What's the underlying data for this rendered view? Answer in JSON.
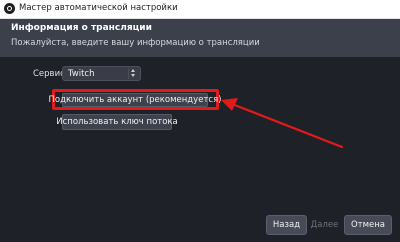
{
  "window": {
    "title": "Мастер автоматической настройки"
  },
  "header": {
    "heading": "Информация о трансляции",
    "subtitle": "Пожалуйста, введите вашу информацию о трансляции"
  },
  "form": {
    "service_label": "Сервис",
    "service_value": "Twitch",
    "connect_button": "Подключить аккаунт (рекомендуется)",
    "stream_key_button": "Использовать ключ потока"
  },
  "footer": {
    "back": "Назад",
    "next": "Далее",
    "cancel": "Отмена"
  },
  "colors": {
    "highlight": "#e21a1a",
    "background": "#1f2128",
    "header": "#3c404b"
  },
  "icons": [
    "app-icon",
    "select-arrows-icon",
    "pointer-arrow"
  ]
}
